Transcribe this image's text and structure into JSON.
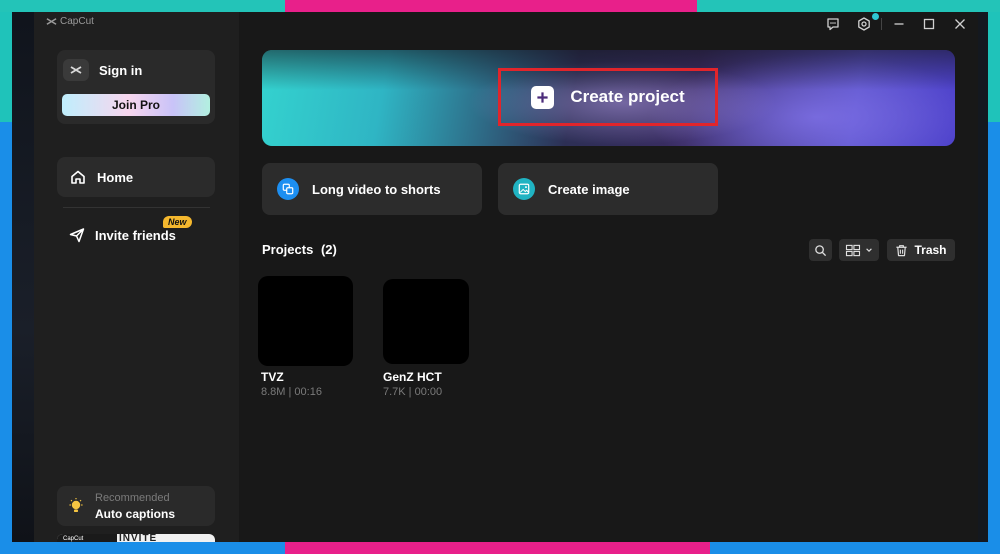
{
  "app": {
    "brand": "CapCut"
  },
  "sidebar": {
    "signin_label": "Sign in",
    "join_pro_label": "Join Pro",
    "home_label": "Home",
    "invite_label": "Invite friends",
    "new_badge": "New",
    "recommended": {
      "subtitle": "Recommended",
      "title": "Auto captions"
    },
    "promo": {
      "left_text": "CapCut",
      "right_text": "INVITE"
    }
  },
  "main": {
    "create_project_label": "Create project",
    "quick_actions": [
      {
        "label": "Long video to shorts",
        "icon": "shorts-icon"
      },
      {
        "label": "Create image",
        "icon": "image-icon"
      }
    ],
    "projects_title": "Projects",
    "projects_count": "(2)",
    "trash_label": "Trash",
    "projects": [
      {
        "name": "TVZ",
        "meta": "8.8M | 00:16"
      },
      {
        "name": "GenZ HCT",
        "meta": "7.7K | 00:00"
      }
    ]
  },
  "colors": {
    "highlight_border": "#e1252b",
    "accent_blue": "#1a8ee8",
    "accent_teal": "#23c4b8",
    "frame_pink": "#e8208a",
    "new_badge": "#f5b82e"
  },
  "icons": [
    "capcut-logo-icon",
    "feedback-icon",
    "settings-icon",
    "minimize-icon",
    "maximize-icon",
    "close-icon",
    "home-icon",
    "send-icon",
    "lightbulb-icon",
    "plus-icon",
    "search-icon",
    "grid-view-icon",
    "chevron-down-icon",
    "trash-icon"
  ]
}
